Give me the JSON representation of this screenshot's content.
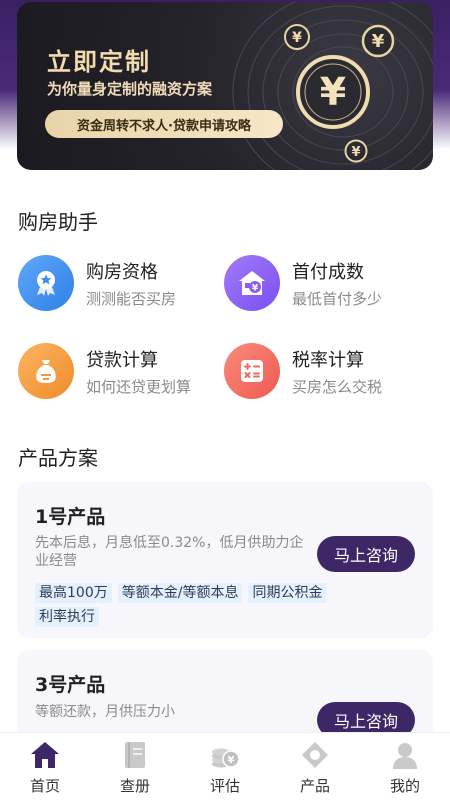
{
  "banner": {
    "title": "立即定制",
    "subtitle": "为你量身定制的融资方案",
    "pill": "资金周转不求人·贷款申请攻略",
    "coin_symbol": "¥"
  },
  "assistant": {
    "title": "购房助手",
    "tools": [
      {
        "name": "购房资格",
        "desc": "测测能否买房",
        "icon": "badge-star-icon",
        "color": "#3d8ef0"
      },
      {
        "name": "首付成数",
        "desc": "最低首付多少",
        "icon": "house-coin-icon",
        "color": "#8a5cf5"
      },
      {
        "name": "贷款计算",
        "desc": "如何还贷更划算",
        "icon": "money-bag-icon",
        "color": "#f59a3b"
      },
      {
        "name": "税率计算",
        "desc": "买房怎么交税",
        "icon": "calculator-icon",
        "color": "#f06a5e"
      }
    ]
  },
  "products": {
    "title": "产品方案",
    "items": [
      {
        "name": "1号产品",
        "desc": "先本后息，月息低至0.32%，低月供助力企业经营",
        "tags": [
          "最高100万",
          "等额本金/等额本息",
          "同期公积金利率执行"
        ],
        "button": "马上咨询"
      },
      {
        "name": "3号产品",
        "desc": "等额还款，月供压力小",
        "button": "马上咨询"
      }
    ]
  },
  "tabbar": {
    "items": [
      {
        "label": "首页",
        "icon": "home-icon",
        "active": true
      },
      {
        "label": "查册",
        "icon": "book-icon",
        "active": false
      },
      {
        "label": "评估",
        "icon": "coins-icon",
        "active": false
      },
      {
        "label": "产品",
        "icon": "diamond-icon",
        "active": false
      },
      {
        "label": "我的",
        "icon": "user-icon",
        "active": false
      }
    ],
    "active_color": "#3d2766",
    "inactive_color": "#c9c9c9"
  }
}
